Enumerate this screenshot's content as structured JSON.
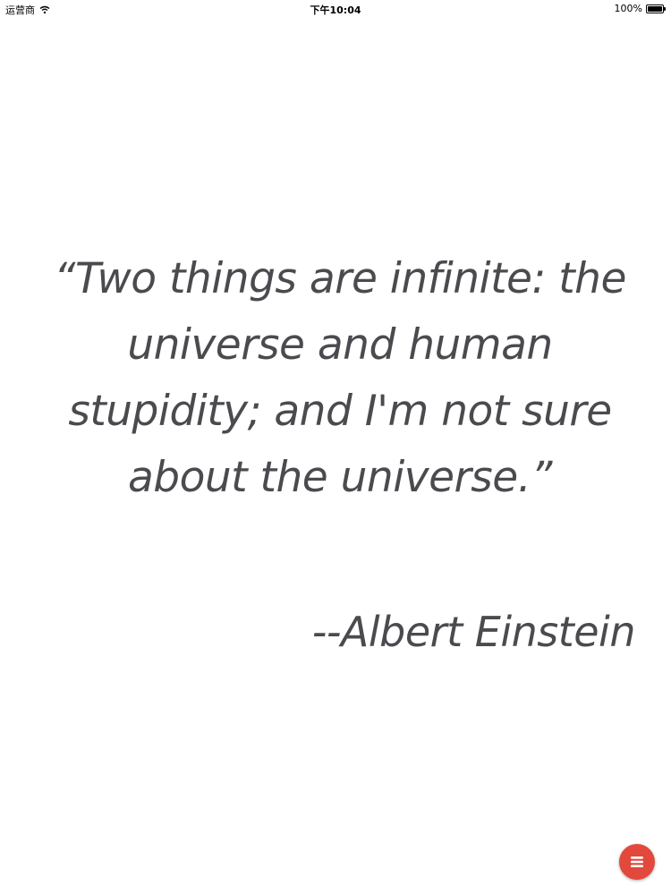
{
  "status_bar": {
    "carrier": "运营商",
    "time": "下午10:04",
    "battery": "100%"
  },
  "quote": {
    "text": "“Two things are infinite: the universe and human stupidity; and I'm not sure about the universe.”",
    "author": "--Albert Einstein"
  },
  "fab": {
    "icon": "menu-icon",
    "color": "#e2483c"
  },
  "colors": {
    "quote_text": "#4a4a4f",
    "background": "#ffffff"
  }
}
